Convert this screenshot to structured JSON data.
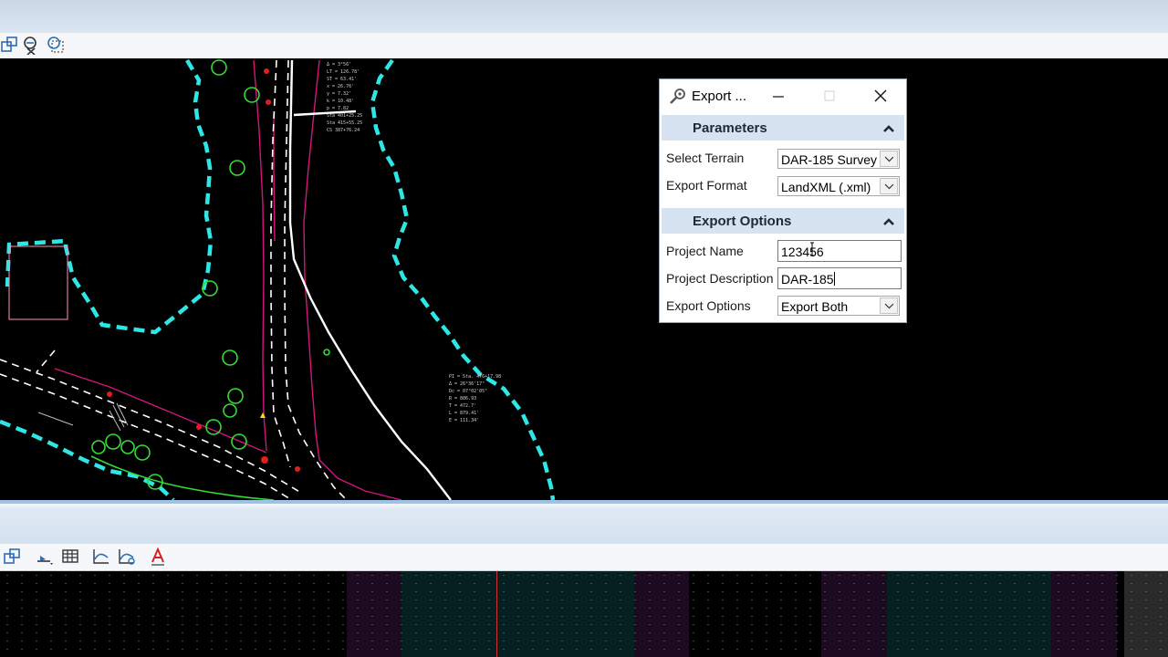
{
  "toolbar_top": {
    "icons": [
      "view-window-icon",
      "clip-tool-icon",
      "view-clip-icon"
    ]
  },
  "toolbar_bottom": {
    "icons": [
      "view-window-icon",
      "level-display-icon",
      "table-icon",
      "profile-view-icon",
      "profile-tool-icon",
      "text-style-icon"
    ]
  },
  "dialog": {
    "title": "Export ...",
    "sections": {
      "parameters": {
        "title": "Parameters",
        "select_terrain_label": "Select Terrain",
        "select_terrain_value": "DAR-185 Survey",
        "export_format_label": "Export Format",
        "export_format_value": "LandXML (.xml)"
      },
      "export_options": {
        "title": "Export Options",
        "project_name_label": "Project Name",
        "project_name_value": "123456",
        "project_description_label": "Project Description",
        "project_description_value": "DAR-185",
        "export_options_label": "Export Options",
        "export_options_value": "Export Both"
      }
    }
  },
  "colors": {
    "boundary": "#2ee6e6",
    "road_edge": "#d4147e",
    "vegetation": "#33dd33",
    "dialog_section": "#d7e3f0"
  }
}
